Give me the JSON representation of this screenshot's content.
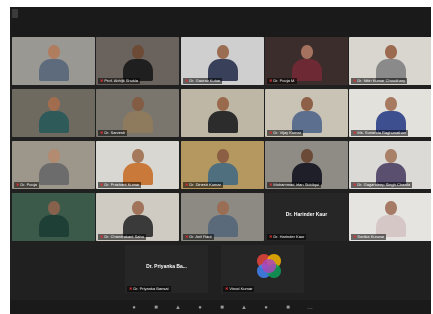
{
  "window": {
    "view_button": "",
    "background": "#202020"
  },
  "participants": [
    {
      "name": "",
      "bg": "#9a9892",
      "skin": "#b07d5e",
      "shirt": "#5d6b7c",
      "muted": true
    },
    {
      "name": "Prof. Abhijit Shukla",
      "bg": "#6a625c",
      "skin": "#6d4a36",
      "shirt": "#1f1f1f",
      "muted": true
    },
    {
      "name": "Dr. Gaurav Kuhar",
      "bg": "#cfcfcf",
      "skin": "#9b6d52",
      "shirt": "#38405a",
      "muted": true
    },
    {
      "name": "Dr. Pooja M.",
      "bg": "#3a2d2b",
      "skin": "#a57260",
      "shirt": "#6e2a34",
      "muted": true
    },
    {
      "name": "Dr. Nitin Kumar Choudhary",
      "bg": "#d8d6cf",
      "skin": "#9b6a4f",
      "shirt": "#8a8a8a",
      "muted": true
    },
    {
      "name": "",
      "bg": "#6f6a60",
      "skin": "#a26d4e",
      "shirt": "#2f5a5a",
      "muted": true
    },
    {
      "name": "Dr. Sarvesh",
      "bg": "#7b766d",
      "skin": "#835c44",
      "shirt": "#8e7a5c",
      "muted": true
    },
    {
      "name": "",
      "bg": "#bfb7a5",
      "skin": "#9a6a4c",
      "shirt": "#2c2c2c",
      "muted": false,
      "active": true
    },
    {
      "name": "Dr. Vijay Kumar",
      "bg": "#c9c3b6",
      "skin": "#8d6047",
      "shirt": "#5d6f8f",
      "muted": true
    },
    {
      "name": "Ms. Sunanda Raghunathan",
      "bg": "#e3e1dc",
      "skin": "#a77b61",
      "shirt": "#3d4f8f",
      "muted": true
    },
    {
      "name": "Dr. Pooja",
      "bg": "#9d978b",
      "skin": "#b28b70",
      "shirt": "#6c6c6c",
      "muted": true
    },
    {
      "name": "Dr. Prashant Kumar",
      "bg": "#d9d7d1",
      "skin": "#a57a5c",
      "shirt": "#c97a3a",
      "muted": true
    },
    {
      "name": "Dr. Dinesh Kumar",
      "bg": "#b5985f",
      "skin": "#8c5f44",
      "shirt": "#4f6f7f",
      "muted": true
    },
    {
      "name": "Mohammad Irfan Siddiqui",
      "bg": "#8f8c86",
      "skin": "#6b4a38",
      "shirt": "#1f1f2a",
      "muted": true
    },
    {
      "name": "Dr. Gagandeep Singh Chawla",
      "bg": "#dcdad6",
      "skin": "#a98068",
      "shirt": "#5a4f6f",
      "muted": true
    },
    {
      "name": "",
      "bg": "#3c5a4a",
      "skin": "#86614b",
      "shirt": "#1d3f35",
      "muted": true
    },
    {
      "name": "Dr. Chandrakant Sahu",
      "bg": "#cfcac2",
      "skin": "#a0735a",
      "shirt": "#3a3a3a",
      "muted": true
    },
    {
      "name": "Dr. Anil Raut",
      "bg": "#8d8a84",
      "skin": "#9a6e55",
      "shirt": "#5a6a7a",
      "muted": true
    },
    {
      "name": "Dr. Harinder Kaur",
      "bg": "#262626",
      "skin": "",
      "shirt": "",
      "muted": true,
      "center_name": "Dr. Harinder Kaur",
      "camera_off": true
    },
    {
      "name": "Sonika Kunwar",
      "bg": "#e6e4e0",
      "skin": "#a67b66",
      "shirt": "#d6c7c7",
      "muted": true
    },
    {
      "name": "Dr. Priyanka Bansal",
      "bg": "#262626",
      "skin": "",
      "shirt": "",
      "muted": true,
      "center_name": "Dr. Priyanka Ba...",
      "camera_off": true
    },
    {
      "name": "Vinod Kumar",
      "bg": "#262626",
      "skin": "",
      "shirt": "",
      "muted": true,
      "logo": true
    }
  ],
  "logo_colors": [
    "#e8453c",
    "#f4b400",
    "#4285f4",
    "#0f9d58",
    "#ab47bc"
  ],
  "toolbar": {
    "icons": [
      "mic-icon",
      "video-icon",
      "security-icon",
      "participants-icon",
      "chat-icon",
      "share-screen-icon",
      "record-icon",
      "reactions-icon",
      "more-icon"
    ]
  }
}
